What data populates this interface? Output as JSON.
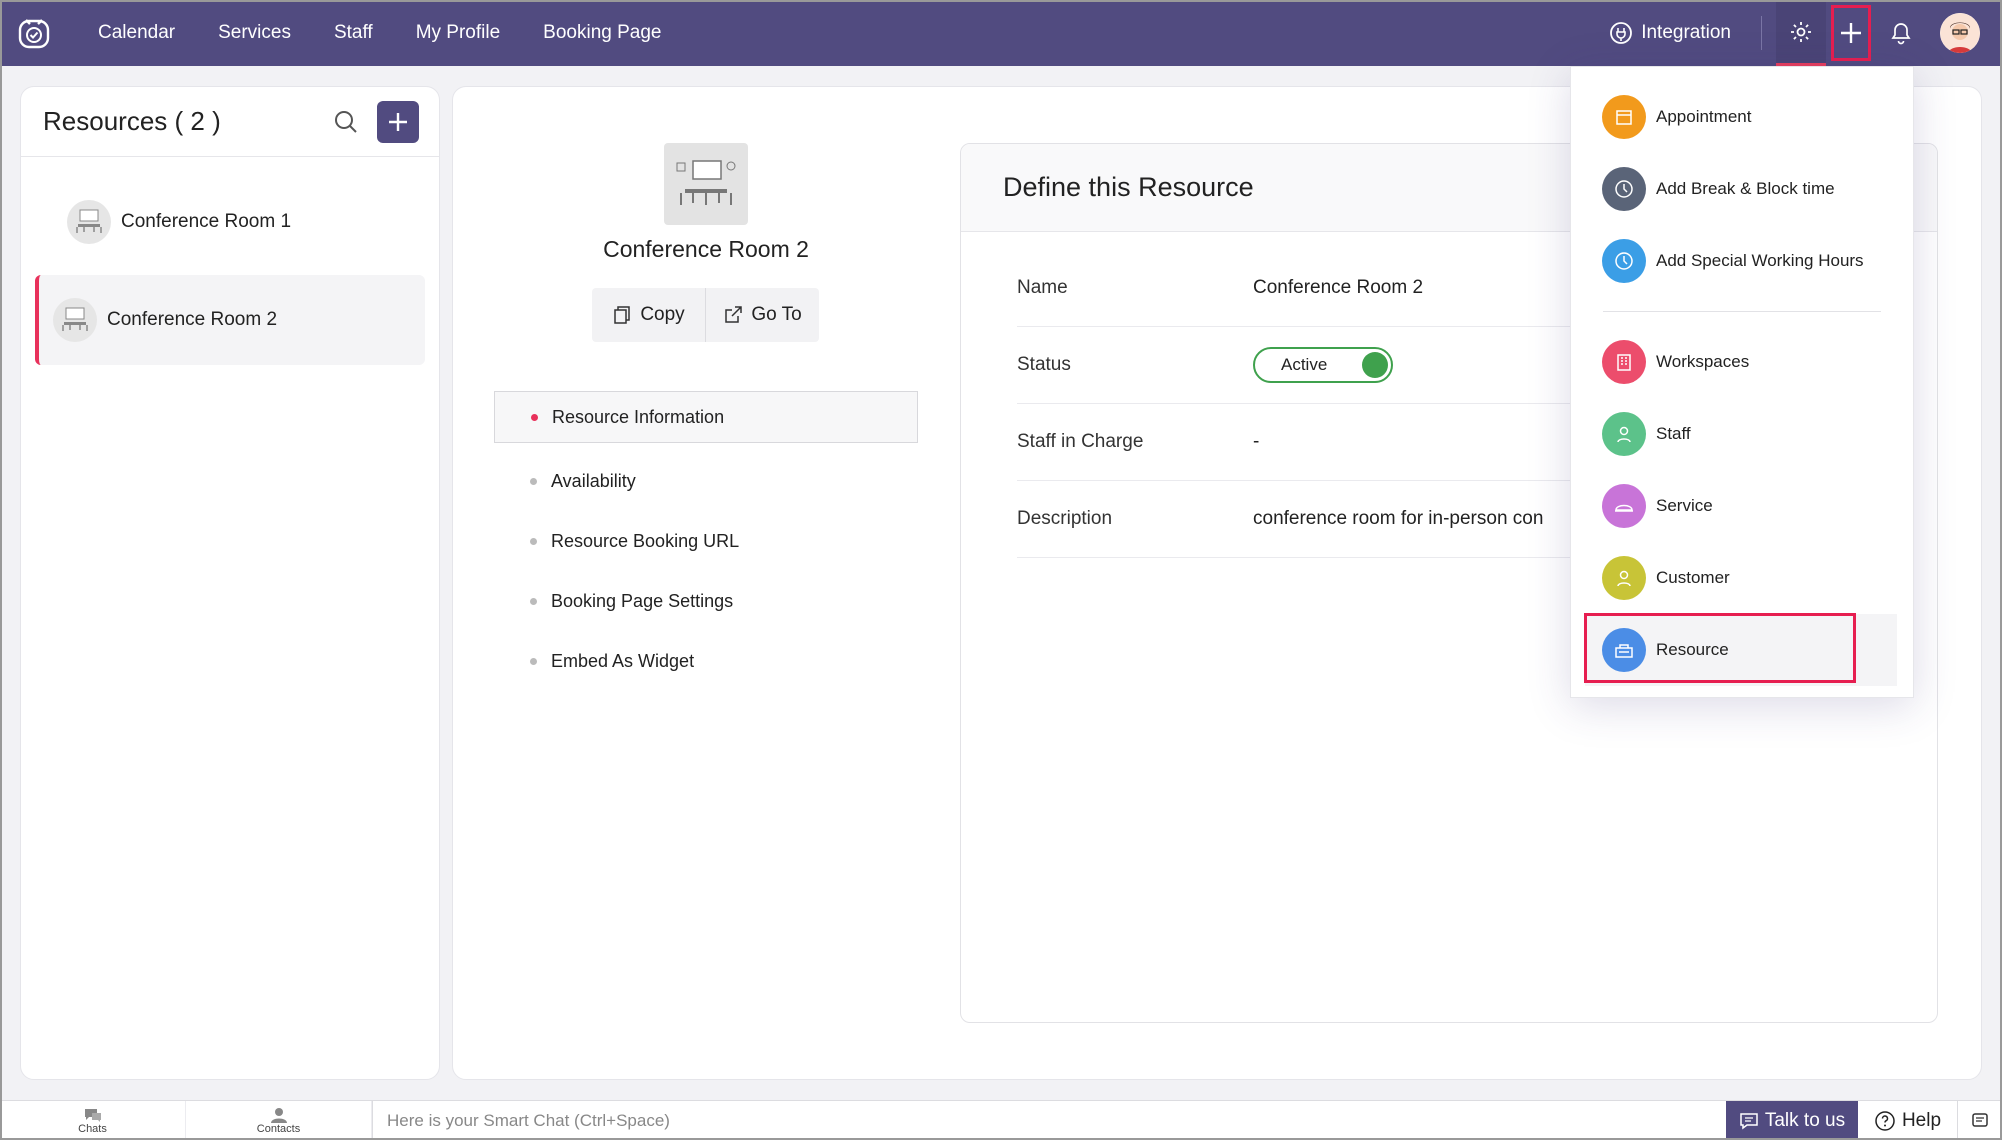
{
  "nav": {
    "items": [
      "Calendar",
      "Services",
      "Staff",
      "My Profile",
      "Booking Page"
    ],
    "integration": "Integration"
  },
  "resources_panel": {
    "title": "Resources ( 2 )",
    "items": [
      {
        "name": "Conference Room 1",
        "selected": false
      },
      {
        "name": "Conference Room 2",
        "selected": true
      }
    ]
  },
  "resource": {
    "name": "Conference Room 2",
    "copy_label": "Copy",
    "goto_label": "Go To"
  },
  "side_menu": {
    "items": [
      "Resource Information",
      "Availability",
      "Resource Booking URL",
      "Booking Page Settings",
      "Embed As Widget"
    ],
    "active_index": 0
  },
  "define": {
    "title": "Define this Resource",
    "fields": [
      {
        "label": "Name",
        "value": "Conference Room 2"
      },
      {
        "label": "Status",
        "value": "Active"
      },
      {
        "label": "Staff in Charge",
        "value": "-"
      },
      {
        "label": "Description",
        "value": "conference room for in-person con"
      }
    ]
  },
  "dropdown": {
    "group1": [
      {
        "label": "Appointment",
        "icon": "calendar-icon",
        "color": "#f29a1c"
      },
      {
        "label": "Add Break & Block time",
        "icon": "clock-icon",
        "color": "#5a6478"
      },
      {
        "label": "Add Special Working Hours",
        "icon": "clock-icon",
        "color": "#3b9ee6"
      }
    ],
    "group2": [
      {
        "label": "Workspaces",
        "icon": "building-icon",
        "color": "#ec4d6c"
      },
      {
        "label": "Staff",
        "icon": "staff-icon",
        "color": "#5cc28a"
      },
      {
        "label": "Service",
        "icon": "service-icon",
        "color": "#c874d8"
      },
      {
        "label": "Customer",
        "icon": "customer-icon",
        "color": "#c8c437"
      },
      {
        "label": "Resource",
        "icon": "resource-icon",
        "color": "#4b8de6"
      }
    ]
  },
  "bottom": {
    "chats": "Chats",
    "contacts": "Contacts",
    "chat_placeholder": "Here is your Smart Chat (Ctrl+Space)",
    "talk": "Talk to us",
    "help": "Help"
  },
  "colors": {
    "topbar": "#514b80",
    "accent_red": "#e8315b",
    "active_green": "#3fa14d"
  }
}
